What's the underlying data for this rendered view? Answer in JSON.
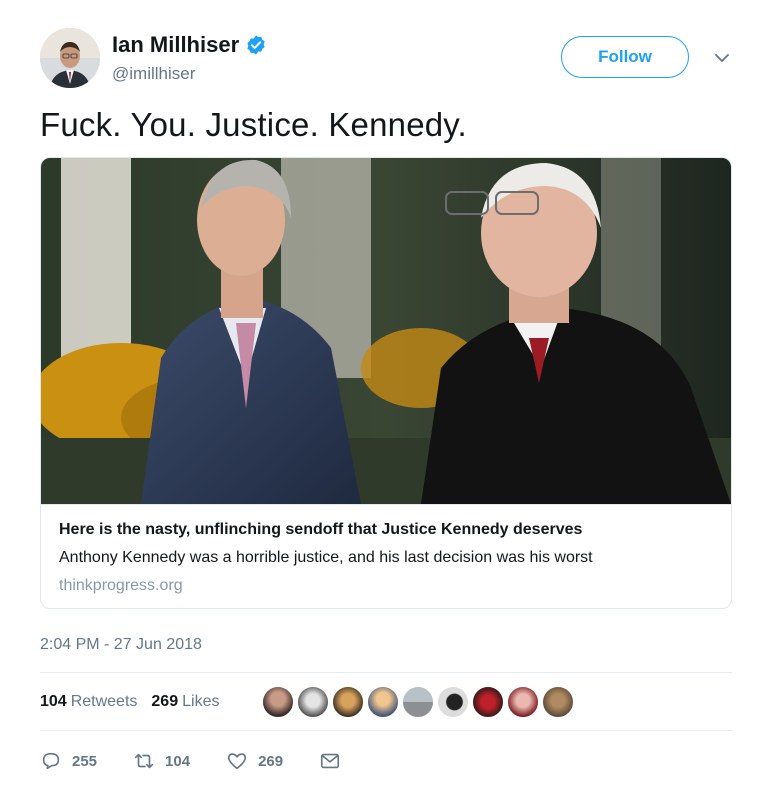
{
  "author": {
    "name": "Ian Millhiser",
    "handle": "@imillhiser",
    "verified": true
  },
  "follow_label": "Follow",
  "tweet_text": "Fuck. You. Justice. Kennedy.",
  "card": {
    "title": "Here is the nasty, unflinching sendoff that Justice Kennedy deserves",
    "description": "Anthony Kennedy was a horrible justice, and his last decision was his worst",
    "domain": "thinkprogress.org"
  },
  "timestamp": "2:04 PM - 27 Jun 2018",
  "stats": {
    "retweets_count": "104",
    "retweets_label": "Retweets",
    "likes_count": "269",
    "likes_label": "Likes"
  },
  "actions": {
    "replies": "255",
    "retweets": "104",
    "likes": "269"
  },
  "colors": {
    "accent": "#1da1f2",
    "secondary_text": "#657786",
    "border": "#e1e8ed"
  },
  "icons": [
    "verified-badge-icon",
    "chevron-down-icon",
    "reply-icon",
    "retweet-icon",
    "like-icon",
    "direct-message-icon"
  ]
}
